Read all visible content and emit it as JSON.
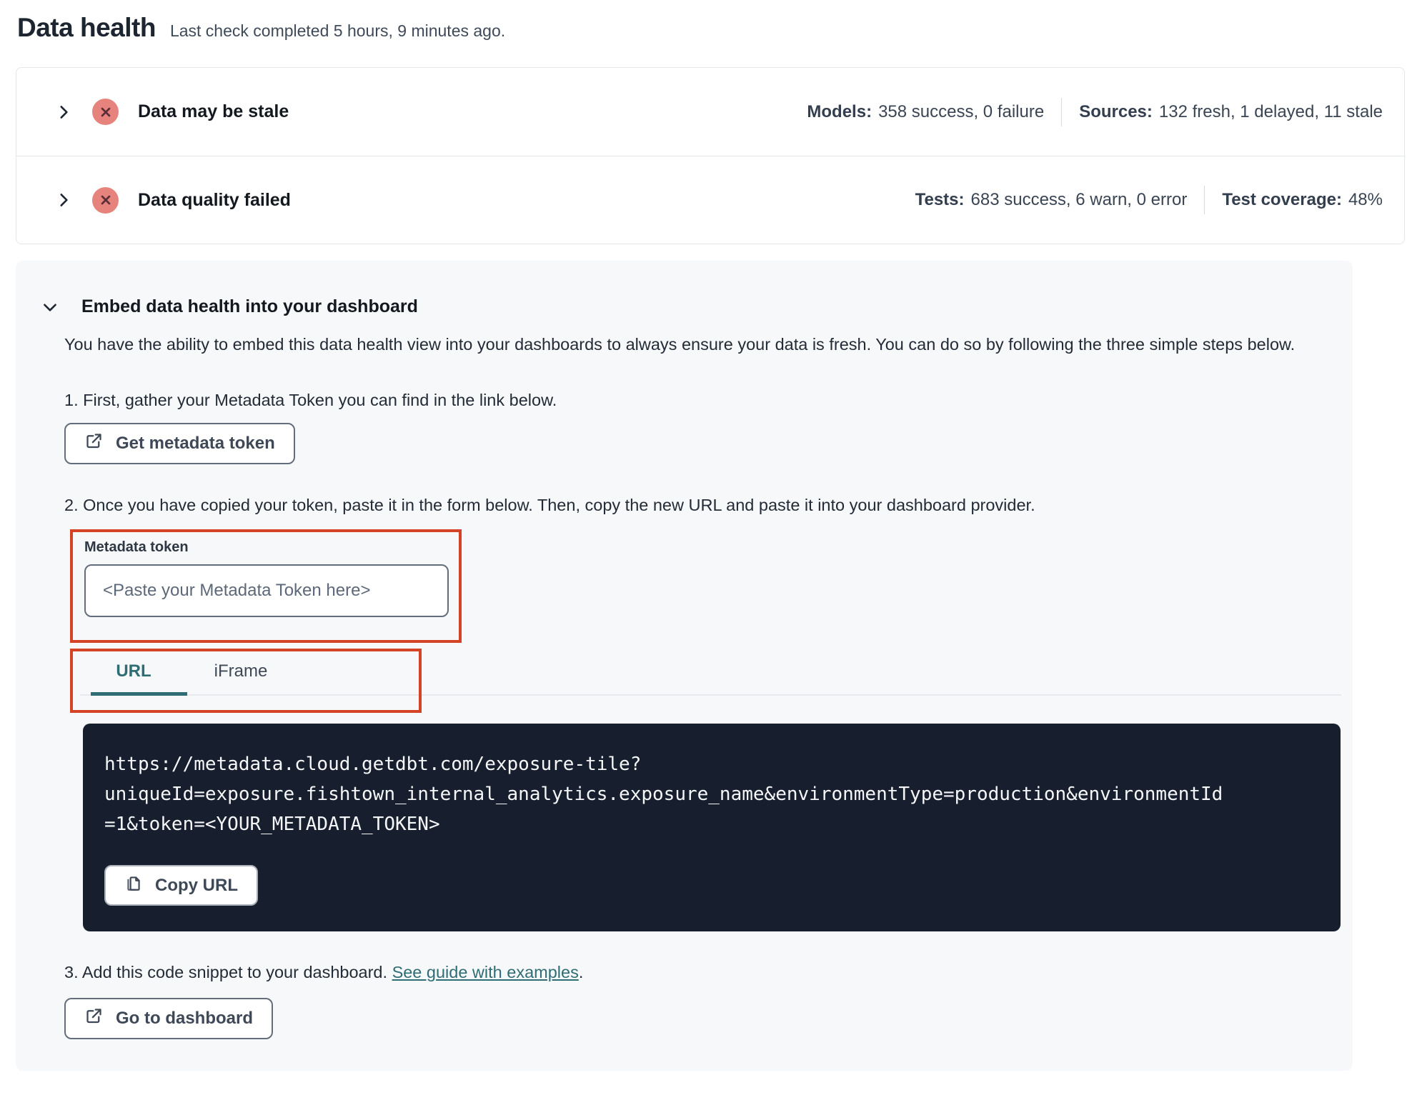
{
  "colors": {
    "accent_teal": "#2e6d73",
    "annotation_red": "#d54327",
    "error_badge_bg": "#e6837d",
    "error_badge_glyph": "#5c2e37",
    "code_block_bg": "#171e2d"
  },
  "header": {
    "title": "Data health",
    "subtitle": "Last check completed 5 hours, 9 minutes ago."
  },
  "status_rows": [
    {
      "title": "Data may be stale",
      "stats": [
        {
          "label": "Models:",
          "value": "358 success, 0 failure"
        },
        {
          "label": "Sources:",
          "value": "132 fresh, 1 delayed, 11 stale"
        }
      ]
    },
    {
      "title": "Data quality failed",
      "stats": [
        {
          "label": "Tests:",
          "value": "683 success, 6 warn, 0 error"
        },
        {
          "label": "Test coverage:",
          "value": "48%"
        }
      ]
    }
  ],
  "embed": {
    "title": "Embed data health into your dashboard",
    "description": "You have the ability to embed this data health view into your dashboards to always ensure your data is fresh. You can do so by following the three simple steps below.",
    "step1": "1. First, gather your Metadata Token you can find in the link below.",
    "get_token_button": "Get metadata token",
    "step2": "2. Once you have copied your token, paste it in the form below. Then, copy the new URL and paste it into your dashboard provider.",
    "token_label": "Metadata token",
    "token_placeholder": "<Paste your Metadata Token here>",
    "tabs": [
      {
        "label": "URL"
      },
      {
        "label": "iFrame"
      }
    ],
    "url_lines": [
      "https://metadata.cloud.getdbt.com/exposure-tile?",
      "uniqueId=exposure.fishtown_internal_analytics.exposure_name&environmentType=production&environmentId",
      "=1&token=<YOUR_METADATA_TOKEN>"
    ],
    "copy_url_button": "Copy URL",
    "step3_text": "3. Add this code snippet to your dashboard. ",
    "step3_link": "See guide with examples",
    "step3_period": ".",
    "dashboard_button": "Go to dashboard"
  }
}
